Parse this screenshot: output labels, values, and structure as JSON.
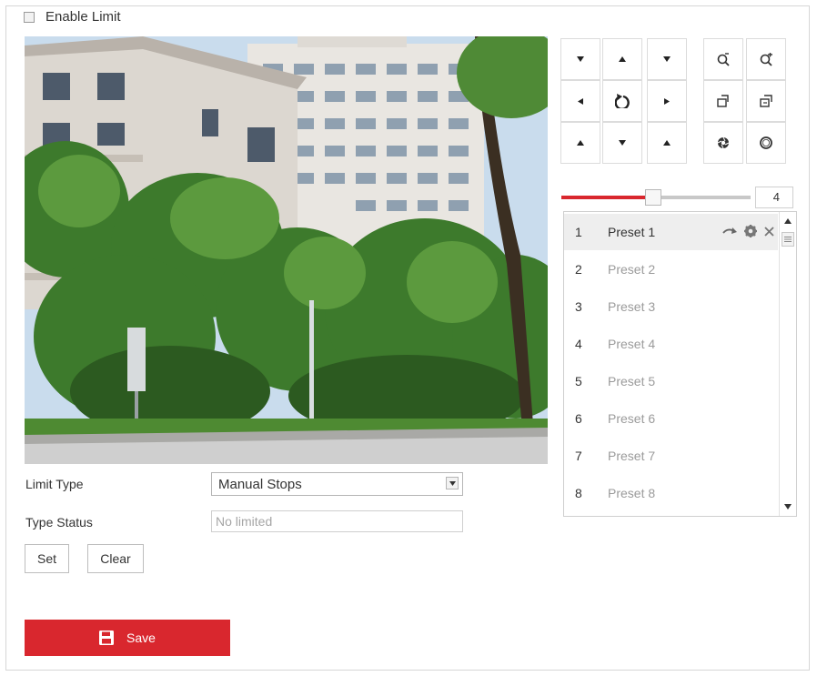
{
  "enable_limit": {
    "label": "Enable Limit",
    "checked": false
  },
  "ptz": {
    "buttons": [
      {
        "name": "pan-down-left-button",
        "icon": "arrow-down-left-icon"
      },
      {
        "name": "tilt-up-button",
        "icon": "arrow-up-icon"
      },
      {
        "name": "pan-down-right-button",
        "icon": "arrow-down-right-icon"
      },
      {
        "name": "zoom-out-button",
        "icon": "zoom-out-icon"
      },
      {
        "name": "zoom-in-button",
        "icon": "zoom-in-icon"
      },
      {
        "name": "pan-left-button",
        "icon": "arrow-left-icon"
      },
      {
        "name": "auto-pan-button",
        "icon": "rotate-icon"
      },
      {
        "name": "pan-right-button",
        "icon": "arrow-right-icon"
      },
      {
        "name": "focus-near-button",
        "icon": "focus-near-icon"
      },
      {
        "name": "focus-far-button",
        "icon": "focus-far-icon"
      },
      {
        "name": "pan-up-left-button",
        "icon": "arrow-up-left-icon"
      },
      {
        "name": "tilt-down-button",
        "icon": "arrow-down-icon"
      },
      {
        "name": "pan-up-right-button",
        "icon": "arrow-up-right-icon"
      },
      {
        "name": "iris-close-button",
        "icon": "iris-close-icon"
      },
      {
        "name": "iris-open-button",
        "icon": "iris-open-icon"
      }
    ],
    "speed": {
      "value": "4",
      "fraction": 0.48
    }
  },
  "presets": [
    {
      "num": "1",
      "name": "Preset 1",
      "selected": true
    },
    {
      "num": "2",
      "name": "Preset 2"
    },
    {
      "num": "3",
      "name": "Preset 3"
    },
    {
      "num": "4",
      "name": "Preset 4"
    },
    {
      "num": "5",
      "name": "Preset 5"
    },
    {
      "num": "6",
      "name": "Preset 6"
    },
    {
      "num": "7",
      "name": "Preset 7"
    },
    {
      "num": "8",
      "name": "Preset 8"
    }
  ],
  "form": {
    "limit_type_label": "Limit Type",
    "limit_type_value": "Manual Stops",
    "type_status_label": "Type Status",
    "type_status_value": "No limited",
    "set_label": "Set",
    "clear_label": "Clear"
  },
  "save_label": "Save",
  "colors": {
    "accent": "#d9272e",
    "border": "#d6d6d6"
  }
}
